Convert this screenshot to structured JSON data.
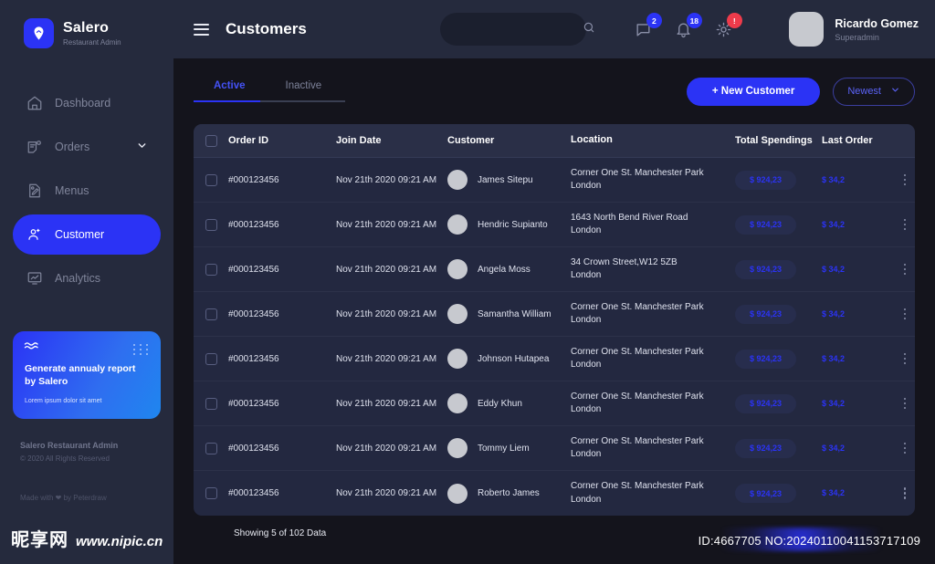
{
  "brand": {
    "name": "Salero",
    "subtitle": "Restaurant Admin",
    "logo_icon": "location-pin-icon"
  },
  "sidebar": {
    "items": [
      {
        "label": "Dashboard",
        "icon": "home-icon",
        "active": false,
        "chevron": false
      },
      {
        "label": "Orders",
        "icon": "orders-icon",
        "active": false,
        "chevron": true
      },
      {
        "label": "Menus",
        "icon": "menu-edit-icon",
        "active": false,
        "chevron": false
      },
      {
        "label": "Customer",
        "icon": "customer-icon",
        "active": true,
        "chevron": false
      },
      {
        "label": "Analytics",
        "icon": "analytics-icon",
        "active": false,
        "chevron": false
      }
    ],
    "promo": {
      "title": "Generate annualy report by Salero",
      "subtitle": "Lorem ipsum dolor sit amet",
      "icon": "wave-icon"
    },
    "footer": {
      "line1": "Salero Restaurant Admin",
      "line2": "© 2020 All Rights Reserved",
      "line3": "Made with ❤ by Peterdraw"
    }
  },
  "topbar": {
    "menu_icon": "hamburger-icon",
    "title": "Customers",
    "search": {
      "value": "",
      "placeholder": "",
      "icon": "search-icon"
    },
    "icons": [
      {
        "name": "message-icon",
        "badge": "2",
        "alert": false
      },
      {
        "name": "bell-icon",
        "badge": "18",
        "alert": false
      },
      {
        "name": "gear-icon",
        "badge": "!",
        "alert": true
      }
    ],
    "profile": {
      "name": "Ricardo Gomez",
      "role": "Superadmin",
      "avatar": "user-avatar"
    }
  },
  "toolbar": {
    "tabs": [
      {
        "label": "Active",
        "active": true
      },
      {
        "label": "Inactive",
        "active": false
      }
    ],
    "new_customer_label": "+ New Customer",
    "sort_label": "Newest",
    "sort_icon": "chevron-down-icon"
  },
  "table": {
    "columns": [
      "Order ID",
      "Join Date",
      "Customer",
      "Location",
      "Total Spendings",
      "Last Order"
    ],
    "rows": [
      {
        "order_id": "#000123456",
        "join_date": "Nov 21th 2020 09:21 AM",
        "customer": "James Sitepu",
        "location_line1": "Corner One St. Manchester Park",
        "location_line2": "London",
        "total_spendings": "$ 924,23",
        "last_order": "$ 34,2"
      },
      {
        "order_id": "#000123456",
        "join_date": "Nov 21th 2020 09:21 AM",
        "customer": "Hendric Supianto",
        "location_line1": "1643  North Bend River Road",
        "location_line2": "London",
        "total_spendings": "$ 924,23",
        "last_order": "$ 34,2"
      },
      {
        "order_id": "#000123456",
        "join_date": "Nov 21th 2020 09:21 AM",
        "customer": "Angela Moss",
        "location_line1": "34  Crown Street,W12 5ZB",
        "location_line2": "London",
        "total_spendings": "$ 924,23",
        "last_order": "$ 34,2"
      },
      {
        "order_id": "#000123456",
        "join_date": "Nov 21th 2020 09:21 AM",
        "customer": "Samantha William",
        "location_line1": "Corner One St. Manchester Park",
        "location_line2": "London",
        "total_spendings": "$ 924,23",
        "last_order": "$ 34,2"
      },
      {
        "order_id": "#000123456",
        "join_date": "Nov 21th 2020 09:21 AM",
        "customer": "Johnson Hutapea",
        "location_line1": "Corner One St. Manchester Park",
        "location_line2": "London",
        "total_spendings": "$ 924,23",
        "last_order": "$ 34,2"
      },
      {
        "order_id": "#000123456",
        "join_date": "Nov 21th 2020 09:21 AM",
        "customer": "Eddy Khun",
        "location_line1": "Corner One St. Manchester Park",
        "location_line2": "London",
        "total_spendings": "$ 924,23",
        "last_order": "$ 34,2"
      },
      {
        "order_id": "#000123456",
        "join_date": "Nov 21th 2020 09:21 AM",
        "customer": "Tommy Liem",
        "location_line1": "Corner One St. Manchester Park",
        "location_line2": "London",
        "total_spendings": "$ 924,23",
        "last_order": "$ 34,2"
      },
      {
        "order_id": "#000123456",
        "join_date": "Nov 21th 2020 09:21 AM",
        "customer": "Roberto James",
        "location_line1": "Corner One St. Manchester Park",
        "location_line2": "London",
        "total_spendings": "$ 924,23",
        "last_order": "$ 34,2"
      }
    ],
    "showing_text": "Showing 5 of 102 Data"
  },
  "watermark": {
    "logo_cn": "昵享网",
    "url": "www.nipic.cn",
    "id_text": "ID:4667705 NO:20240110041153717109"
  },
  "colors": {
    "accent": "#2b33f5",
    "alert": "#ef3b4b",
    "sidebar_bg": "#252a3d",
    "card_bg": "#232840",
    "page_bg": "#14141c"
  }
}
